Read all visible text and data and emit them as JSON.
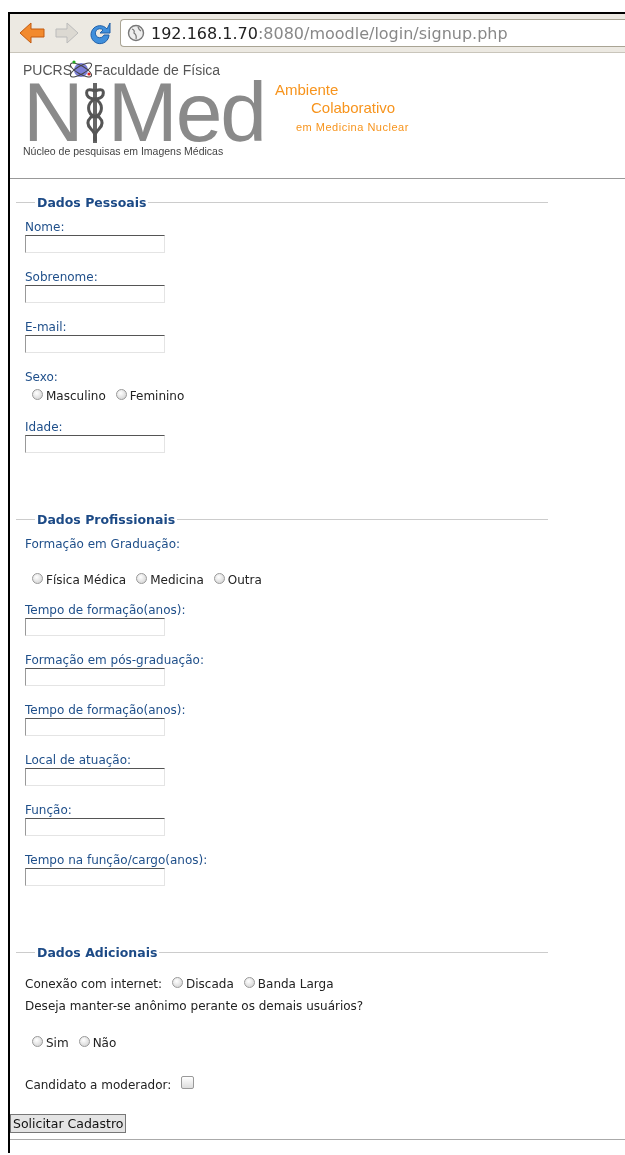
{
  "browser": {
    "url_host": "192.168.1.70",
    "url_path": ":8080/moodle/login/signup.php"
  },
  "logo": {
    "institution": "PUCRS",
    "faculty": "Faculdade de Física",
    "mark_left": "N",
    "mark_right": "Med",
    "subtitle": "Núcleo de pesquisas em Imagens Médicas",
    "tagline_1": "Ambiente",
    "tagline_2": "Colaborativo",
    "tagline_3": "em Medicina Nuclear"
  },
  "sections": [
    {
      "legend": "Dados Pessoais",
      "items": [
        {
          "kind": "field",
          "label": "Nome:"
        },
        {
          "kind": "field",
          "label": "Sobrenome:"
        },
        {
          "kind": "field",
          "label": "E-mail:"
        },
        {
          "kind": "radios",
          "label": "Sexo:",
          "options": [
            {
              "label": "Masculino",
              "selected": false
            },
            {
              "label": "Feminino",
              "selected": false
            }
          ]
        },
        {
          "kind": "field",
          "label": "Idade:"
        }
      ]
    },
    {
      "legend": "Dados Profissionais",
      "items": [
        {
          "kind": "question",
          "label": "Formação em Graduação:",
          "options": [
            {
              "label": "Física Médica",
              "selected": false
            },
            {
              "label": "Medicina",
              "selected": false
            },
            {
              "label": "Outra",
              "selected": false
            }
          ]
        },
        {
          "kind": "field",
          "label": "Tempo de formação(anos):"
        },
        {
          "kind": "field",
          "label": "Formação em pós-graduação:"
        },
        {
          "kind": "field",
          "label": "Tempo de formação(anos):"
        },
        {
          "kind": "field",
          "label": "Local de atuação:"
        },
        {
          "kind": "field",
          "label": "Função:"
        },
        {
          "kind": "field",
          "label": "Tempo na função/cargo(anos):"
        }
      ]
    },
    {
      "legend": "Dados Adicionais",
      "items": [
        {
          "kind": "inline_radios",
          "label": "Conexão com internet:",
          "options": [
            {
              "label": "Discada",
              "selected": false
            },
            {
              "label": "Banda Larga",
              "selected": false
            }
          ]
        },
        {
          "kind": "prompt",
          "label": "Deseja manter-se anônimo perante os demais usuários?",
          "options": [
            {
              "label": "Sim",
              "selected": false
            },
            {
              "label": "Não",
              "selected": false
            }
          ]
        },
        {
          "kind": "checkbox",
          "label": "Candidato a moderador:",
          "checked": false
        }
      ]
    }
  ],
  "submit": "Solicitar Cadastro"
}
